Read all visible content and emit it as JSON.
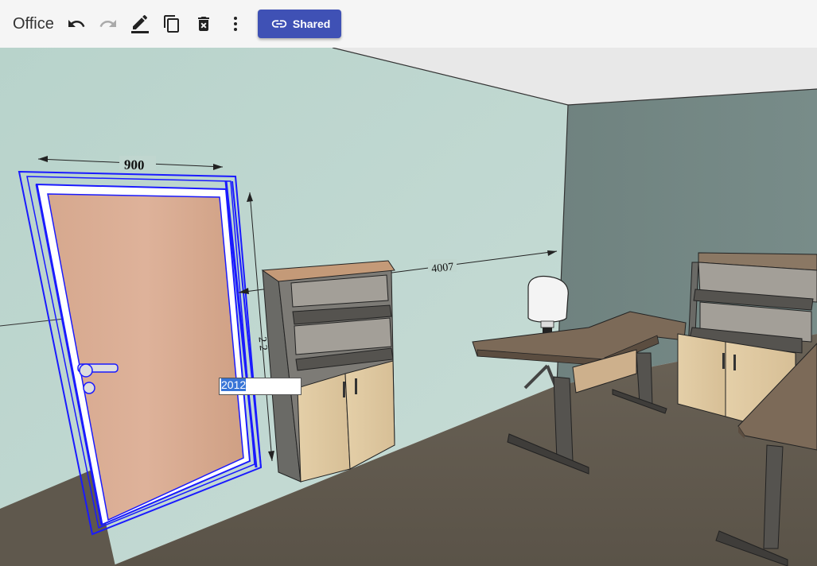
{
  "toolbar": {
    "title": "Office",
    "undo_icon": "undo-icon",
    "redo_icon": "redo-icon",
    "edit_icon": "pencil-icon",
    "copy_icon": "copy-icon",
    "delete_icon": "trash-icon",
    "more_icon": "more-vert-icon",
    "share_label": "Shared",
    "share_icon": "link-icon",
    "accent": "#3f51b5"
  },
  "scene": {
    "dimensions": {
      "door_width": "900",
      "wall_length": "4007",
      "door_height_partial": "2  2"
    },
    "edit_field_value": "2012"
  }
}
